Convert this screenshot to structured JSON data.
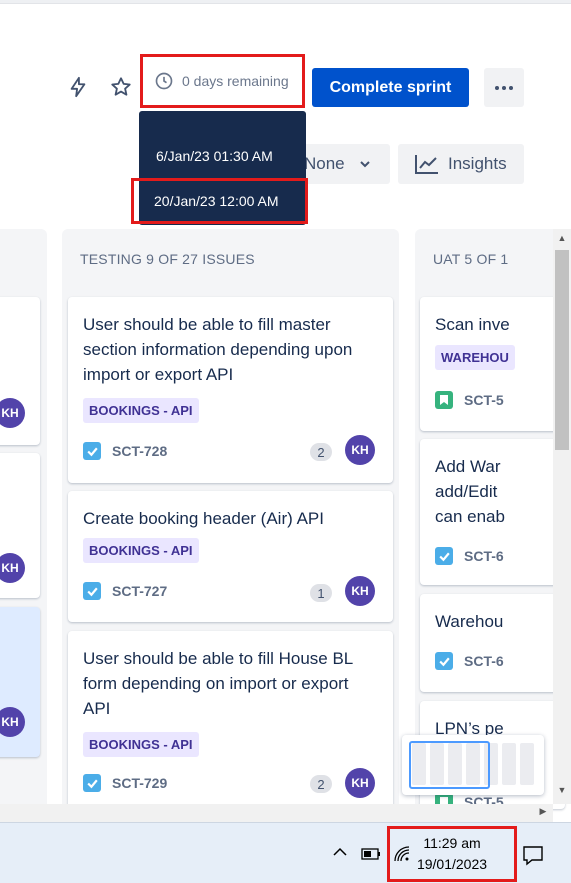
{
  "header": {
    "lightning_icon": "lightning-icon",
    "star_icon": "star-icon",
    "timer_text": "0 days remaining",
    "complete_label": "Complete sprint",
    "group_label": "None",
    "insights_label": "Insights"
  },
  "tooltip": {
    "start": "6/Jan/23 01:30 AM",
    "end": "20/Jan/23 12:00 AM"
  },
  "columns": [
    {
      "title": "TESTING 9 OF 27 ISSUES"
    },
    {
      "title": "UAT 5 OF 1"
    }
  ],
  "testing_cards": [
    {
      "title": "User should be able to fill master section information depending upon import or export API",
      "epic": "BOOKINGS - API",
      "key": "SCT-728",
      "points": "2",
      "avatar": "KH"
    },
    {
      "title": "Create booking header (Air) API",
      "epic": "BOOKINGS - API",
      "key": "SCT-727",
      "points": "1",
      "avatar": "KH"
    },
    {
      "title": "User should be able to fill House BL form depending on import or export API",
      "epic": "BOOKINGS - API",
      "key": "SCT-729",
      "points": "2",
      "avatar": "KH"
    }
  ],
  "uat_cards": [
    {
      "title": "Scan inve",
      "epic": "WAREHOU",
      "key": "SCT-5"
    },
    {
      "title": "Add War add/Edit can enab",
      "key": "SCT-6"
    },
    {
      "title": "Warehou",
      "key": "SCT-6"
    },
    {
      "title": "LPN’s pe",
      "key": "SCT-5"
    }
  ],
  "left_avatars": [
    "KH",
    "KH",
    "KH"
  ],
  "taskbar": {
    "time": "11:29 am",
    "date": "19/01/2023"
  },
  "colors": {
    "primary": "#0052cc",
    "highlight": "#e31b1b",
    "epic_bg": "#eae6ff",
    "epic_text": "#403294",
    "avatar": "#5243aa"
  }
}
